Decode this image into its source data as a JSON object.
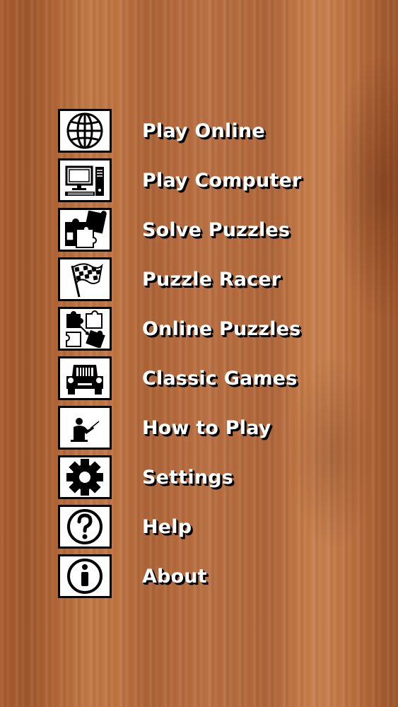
{
  "menu": {
    "items": [
      {
        "label": "Play Online",
        "icon": "globe-icon"
      },
      {
        "label": "Play Computer",
        "icon": "computer-icon"
      },
      {
        "label": "Solve Puzzles",
        "icon": "puzzle-pieces-icon"
      },
      {
        "label": "Puzzle Racer",
        "icon": "checkered-flag-icon"
      },
      {
        "label": "Online Puzzles",
        "icon": "online-puzzle-pieces-icon"
      },
      {
        "label": "Classic Games",
        "icon": "vintage-car-icon"
      },
      {
        "label": "How to Play",
        "icon": "teacher-icon"
      },
      {
        "label": "Settings",
        "icon": "gear-icon"
      },
      {
        "label": "Help",
        "icon": "question-mark-icon"
      },
      {
        "label": "About",
        "icon": "info-icon"
      }
    ]
  },
  "colors": {
    "label_text": "#ffffff",
    "label_shadow": "#000000",
    "icon_background": "#ffffff",
    "icon_border": "#000000",
    "wood": "#b5683a"
  }
}
